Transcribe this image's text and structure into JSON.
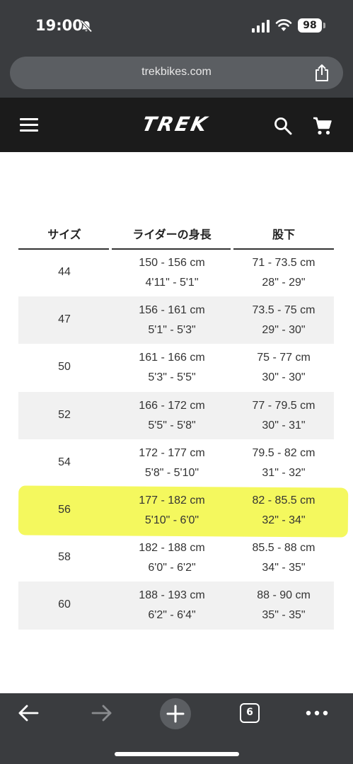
{
  "status_bar": {
    "time": "19:00",
    "battery": "98"
  },
  "browser": {
    "url": "trekbikes.com"
  },
  "header": {
    "logo_text": "TREK"
  },
  "size_table": {
    "columns": [
      "サイズ",
      "ライダーの身長",
      "股下"
    ],
    "rows": [
      {
        "size": "44",
        "height_cm": "150 - 156 cm",
        "height_ft": "4'11\" - 5'1\"",
        "inseam_cm": "71 - 73.5 cm",
        "inseam_in": "28\" - 29\""
      },
      {
        "size": "47",
        "height_cm": "156 - 161 cm",
        "height_ft": "5'1\" - 5'3\"",
        "inseam_cm": "73.5 - 75 cm",
        "inseam_in": "29\" - 30\""
      },
      {
        "size": "50",
        "height_cm": "161 - 166 cm",
        "height_ft": "5'3\" - 5'5\"",
        "inseam_cm": "75 - 77 cm",
        "inseam_in": "30\" - 30\""
      },
      {
        "size": "52",
        "height_cm": "166 - 172 cm",
        "height_ft": "5'5\" - 5'8\"",
        "inseam_cm": "77 - 79.5 cm",
        "inseam_in": "30\" - 31\""
      },
      {
        "size": "54",
        "height_cm": "172 - 177 cm",
        "height_ft": "5'8\" - 5'10\"",
        "inseam_cm": "79.5 - 82 cm",
        "inseam_in": "31\" - 32\""
      },
      {
        "size": "56",
        "height_cm": "177 - 182 cm",
        "height_ft": "5'10\" - 6'0\"",
        "inseam_cm": "82 - 85.5 cm",
        "inseam_in": "32\" - 34\""
      },
      {
        "size": "58",
        "height_cm": "182 - 188 cm",
        "height_ft": "6'0\" - 6'2\"",
        "inseam_cm": "85.5 - 88 cm",
        "inseam_in": "34\" - 35\""
      },
      {
        "size": "60",
        "height_cm": "188 - 193 cm",
        "height_ft": "6'2\" - 6'4\"",
        "inseam_cm": "88 - 90 cm",
        "inseam_in": "35\" - 35\""
      }
    ]
  },
  "bottom_bar": {
    "tab_count": "6"
  },
  "colors": {
    "chrome_bg": "#3a3c3f",
    "header_bg": "#1b1b1b",
    "highlight": "#f0f528",
    "row_alt": "#f1f1f1"
  }
}
